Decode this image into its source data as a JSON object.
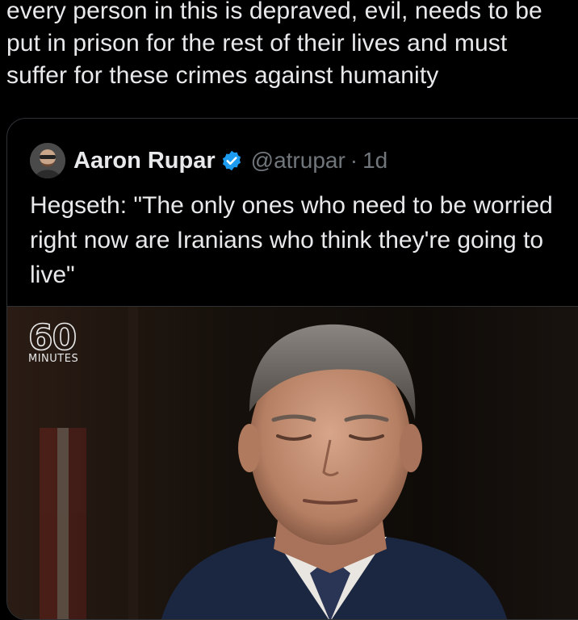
{
  "post": {
    "text": "every person in this is depraved, evil, needs to be put in prison for the rest of their lives and must suffer for these crimes against humanity"
  },
  "quote": {
    "author_name": "Aaron Rupar",
    "handle": "@atrupar",
    "separator": "·",
    "time": "1d",
    "verified": true,
    "verified_color": "#1d9bf0",
    "avatar_icon": "profile-photo",
    "text": "Hegseth: \"The only ones who need to be worried right now are Iranians who think they're going to live\"",
    "media": {
      "logo_number": "60",
      "logo_word": "MINUTES"
    }
  },
  "colors": {
    "background": "#000000",
    "text_primary": "#e7e9ea",
    "text_secondary": "#71767b",
    "border": "#2f3336"
  }
}
